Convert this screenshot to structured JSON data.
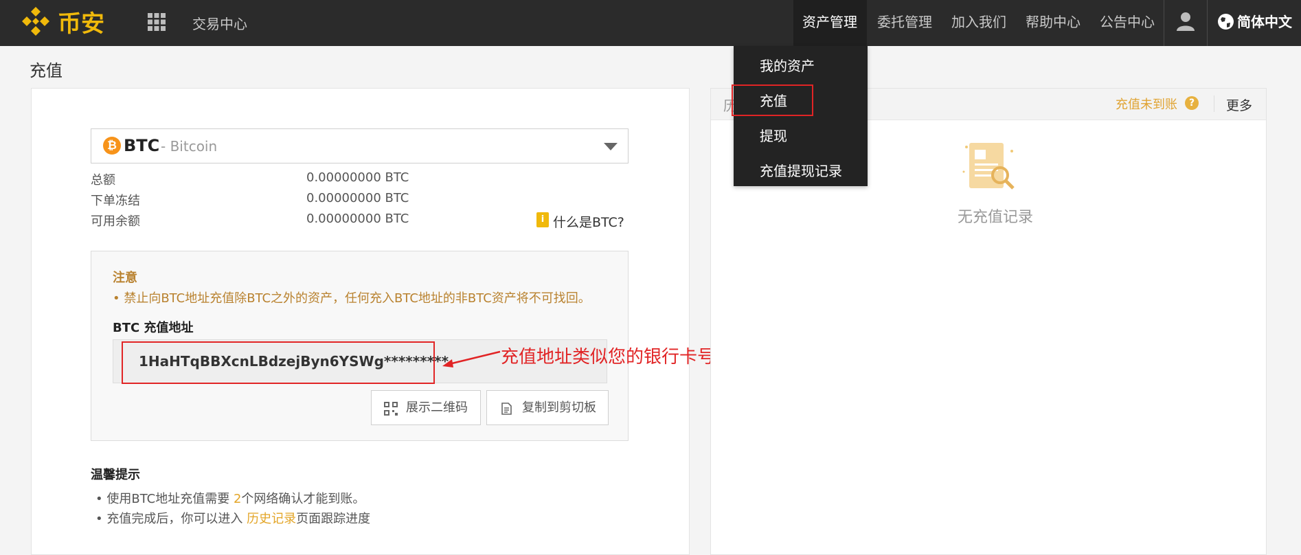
{
  "header": {
    "brand": "币安",
    "trade_center": "交易中心",
    "nav": [
      "资产管理",
      "委托管理",
      "加入我们",
      "帮助中心",
      "公告中心"
    ],
    "language": "简体中文"
  },
  "page": {
    "title": "充值"
  },
  "asset_select": {
    "symbol": "BTC",
    "name": "- Bitcoin"
  },
  "balances": [
    {
      "label": "总额",
      "value": "0.00000000 BTC"
    },
    {
      "label": "下单冻结",
      "value": "0.00000000 BTC"
    },
    {
      "label": "可用余额",
      "value": "0.00000000 BTC"
    }
  ],
  "what_is": "什么是BTC?",
  "notice": {
    "title": "注意",
    "text": "• 禁止向BTC地址充值除BTC之外的资产，任何充入BTC地址的非BTC资产将不可找回。",
    "address_label": "BTC 充值地址",
    "address": "1HaHTqBBXcnLBdzejByn6YSWg*********",
    "btn_qr": "展示二维码",
    "btn_copy": "复制到剪切板"
  },
  "tips": {
    "title": "温馨提示",
    "t1_prefix": "使用BTC地址充值需要 ",
    "t1_num": "2",
    "t1_suffix": "个网络确认才能到账。",
    "t2_prefix": "充值完成后，你可以进入 ",
    "t2_link": "历史记录",
    "t2_suffix": "页面跟踪进度"
  },
  "annotation": "充值地址类似您的银行卡号",
  "dropdown": [
    "我的资产",
    "充值",
    "提现",
    "充值提现记录"
  ],
  "history": {
    "title_partial": "历",
    "not_arrived": "充值未到账",
    "more": "更多",
    "empty": "无充值记录"
  }
}
